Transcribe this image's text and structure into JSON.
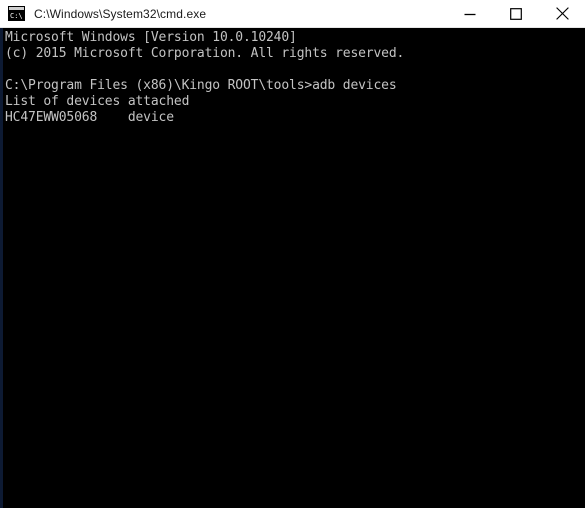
{
  "window": {
    "title": "C:\\Windows\\System32\\cmd.exe",
    "icon": "cmd-console-icon",
    "background_color": "#000000",
    "titlebar_color": "#ffffff",
    "text_color": "#c3c3c3",
    "border_color": "#0d1a33"
  },
  "titlebar": {
    "minimize_label": "minimize-icon",
    "maximize_label": "maximize-icon",
    "close_label": "close-icon"
  },
  "console": {
    "prompt_path": "C:\\Program Files (x86)\\Kingo ROOT\\tools>",
    "command": "adb devices",
    "device_serial": "HC47EWW05068",
    "device_state": "device",
    "lines": [
      "Microsoft Windows [Version 10.0.10240]",
      "(c) 2015 Microsoft Corporation. All rights reserved.",
      "",
      "C:\\Program Files (x86)\\Kingo ROOT\\tools>adb devices",
      "List of devices attached",
      "HC47EWW05068    device"
    ]
  }
}
